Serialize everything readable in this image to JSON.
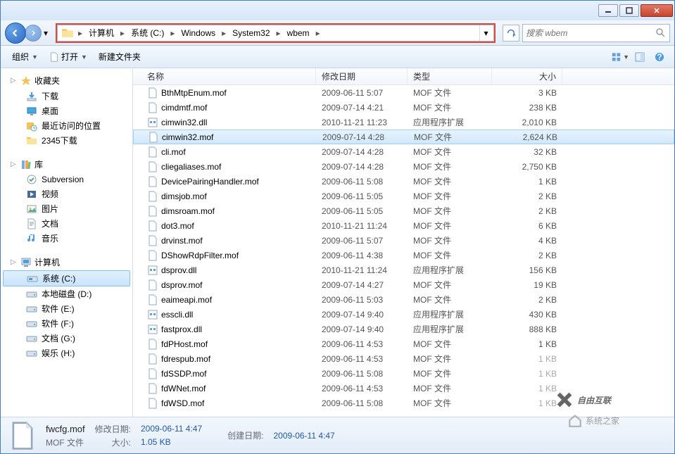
{
  "breadcrumb": [
    "计算机",
    "系统 (C:)",
    "Windows",
    "System32",
    "wbem"
  ],
  "search": {
    "placeholder": "搜索 wbem"
  },
  "toolbar": {
    "organize": "组织",
    "open": "打开",
    "new_folder": "新建文件夹"
  },
  "columns": {
    "name": "名称",
    "date": "修改日期",
    "type": "类型",
    "size": "大小"
  },
  "sidebar": {
    "favorites": {
      "label": "收藏夹",
      "items": [
        "下载",
        "桌面",
        "最近访问的位置",
        "2345下载"
      ]
    },
    "libraries": {
      "label": "库",
      "items": [
        "Subversion",
        "视频",
        "图片",
        "文档",
        "音乐"
      ]
    },
    "computer": {
      "label": "计算机",
      "items": [
        "系统 (C:)",
        "本地磁盘 (D:)",
        "软件 (E:)",
        "软件 (F:)",
        "文档 (G:)",
        "娱乐 (H:)"
      ],
      "selected": 0
    }
  },
  "files": [
    {
      "name": "BthMtpEnum.mof",
      "date": "2009-06-11 5:07",
      "type": "MOF 文件",
      "size": "3 KB",
      "ico": "file"
    },
    {
      "name": "cimdmtf.mof",
      "date": "2009-07-14 4:21",
      "type": "MOF 文件",
      "size": "238 KB",
      "ico": "file"
    },
    {
      "name": "cimwin32.dll",
      "date": "2010-11-21 11:23",
      "type": "应用程序扩展",
      "size": "2,010 KB",
      "ico": "dll"
    },
    {
      "name": "cimwin32.mof",
      "date": "2009-07-14 4:28",
      "type": "MOF 文件",
      "size": "2,624 KB",
      "ico": "file",
      "selected": true
    },
    {
      "name": "cli.mof",
      "date": "2009-07-14 4:28",
      "type": "MOF 文件",
      "size": "32 KB",
      "ico": "file"
    },
    {
      "name": "cliegaliases.mof",
      "date": "2009-07-14 4:28",
      "type": "MOF 文件",
      "size": "2,750 KB",
      "ico": "file"
    },
    {
      "name": "DevicePairingHandler.mof",
      "date": "2009-06-11 5:08",
      "type": "MOF 文件",
      "size": "1 KB",
      "ico": "file"
    },
    {
      "name": "dimsjob.mof",
      "date": "2009-06-11 5:05",
      "type": "MOF 文件",
      "size": "2 KB",
      "ico": "file"
    },
    {
      "name": "dimsroam.mof",
      "date": "2009-06-11 5:05",
      "type": "MOF 文件",
      "size": "2 KB",
      "ico": "file"
    },
    {
      "name": "dot3.mof",
      "date": "2010-11-21 11:24",
      "type": "MOF 文件",
      "size": "6 KB",
      "ico": "file"
    },
    {
      "name": "drvinst.mof",
      "date": "2009-06-11 5:07",
      "type": "MOF 文件",
      "size": "4 KB",
      "ico": "file"
    },
    {
      "name": "DShowRdpFilter.mof",
      "date": "2009-06-11 4:38",
      "type": "MOF 文件",
      "size": "2 KB",
      "ico": "file"
    },
    {
      "name": "dsprov.dll",
      "date": "2010-11-21 11:24",
      "type": "应用程序扩展",
      "size": "156 KB",
      "ico": "dll"
    },
    {
      "name": "dsprov.mof",
      "date": "2009-07-14 4:27",
      "type": "MOF 文件",
      "size": "19 KB",
      "ico": "file"
    },
    {
      "name": "eaimeapi.mof",
      "date": "2009-06-11 5:03",
      "type": "MOF 文件",
      "size": "2 KB",
      "ico": "file"
    },
    {
      "name": "esscli.dll",
      "date": "2009-07-14 9:40",
      "type": "应用程序扩展",
      "size": "430 KB",
      "ico": "dll"
    },
    {
      "name": "fastprox.dll",
      "date": "2009-07-14 9:40",
      "type": "应用程序扩展",
      "size": "888 KB",
      "ico": "dll"
    },
    {
      "name": "fdPHost.mof",
      "date": "2009-06-11 4:53",
      "type": "MOF 文件",
      "size": "1 KB",
      "ico": "file"
    },
    {
      "name": "fdrespub.mof",
      "date": "2009-06-11 4:53",
      "type": "MOF 文件",
      "size": "1 KB",
      "ico": "file",
      "dim": true
    },
    {
      "name": "fdSSDP.mof",
      "date": "2009-06-11 5:08",
      "type": "MOF 文件",
      "size": "1 KB",
      "ico": "file",
      "dim": true
    },
    {
      "name": "fdWNet.mof",
      "date": "2009-06-11 4:53",
      "type": "MOF 文件",
      "size": "1 KB",
      "ico": "file",
      "dim": true
    },
    {
      "name": "fdWSD.mof",
      "date": "2009-06-11 5:08",
      "type": "MOF 文件",
      "size": "1 KB",
      "ico": "file",
      "dim": true
    }
  ],
  "status": {
    "filename": "fwcfg.mof",
    "filetype": "MOF 文件",
    "mod_label": "修改日期:",
    "mod_val": "2009-06-11 4:47",
    "size_label": "大小:",
    "size_val": "1.05 KB",
    "create_label": "创建日期:",
    "create_val": "2009-06-11 4:47"
  },
  "watermarks": {
    "w1": "自由互联",
    "w2": "系统之家"
  }
}
